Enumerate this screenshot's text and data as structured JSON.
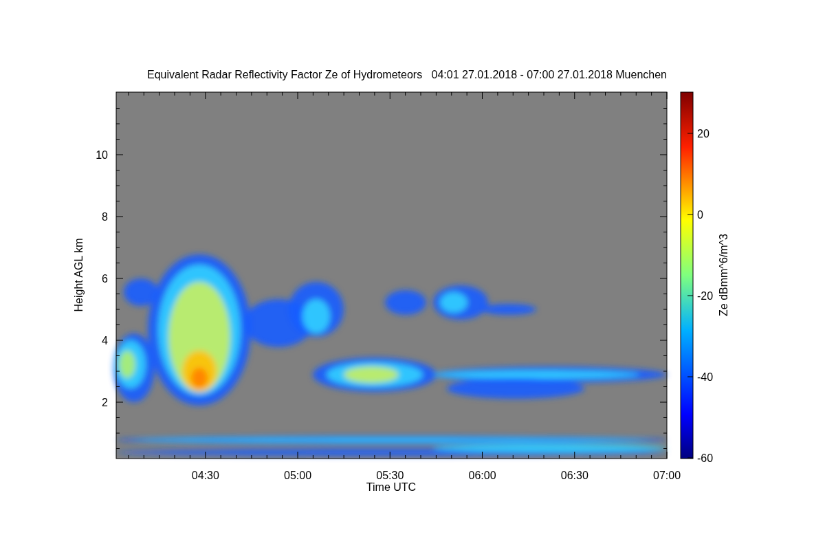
{
  "title": "Equivalent Radar Reflectivity Factor Ze of Hydrometeors   04:01 27.01.2018 - 07:00 27.01.2018 Muenchen",
  "x_axis": {
    "label": "Time UTC",
    "ticks": [
      "04:30",
      "05:00",
      "05:30",
      "06:00",
      "06:30",
      "07:00"
    ]
  },
  "y_axis": {
    "label": "Height AGL km",
    "ticks": [
      "10",
      "8",
      "6",
      "4",
      "2"
    ]
  },
  "colorbar": {
    "label": "Ze dBmm^6/m^3",
    "ticks": [
      "20",
      "0",
      "-20",
      "-40",
      "-60"
    ]
  }
}
